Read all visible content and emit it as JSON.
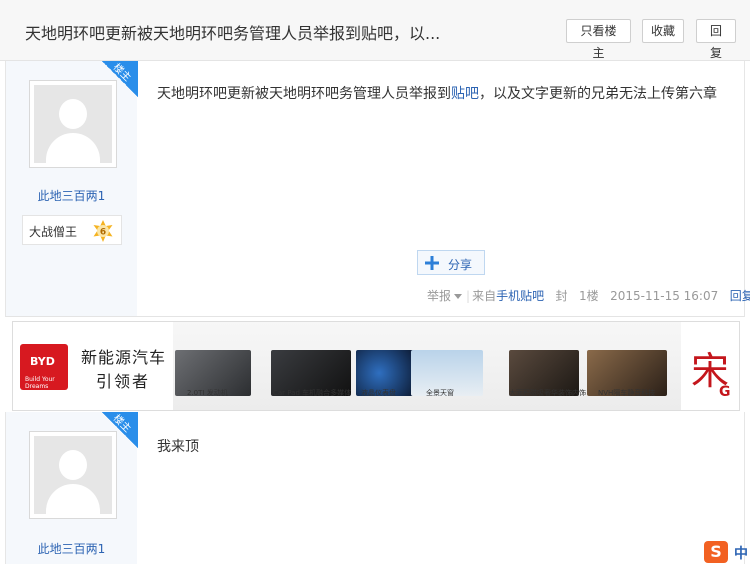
{
  "header": {
    "title": "天地明环吧更新被天地明环吧务管理人员举报到贴吧，以...",
    "buttons": {
      "only_op": "只看楼主",
      "favorite": "收藏",
      "reply": "回复"
    }
  },
  "posts": [
    {
      "corner_label": "楼主",
      "username": "此地三百两1",
      "badge": {
        "title": "大战僧王",
        "level": "6"
      },
      "content_prefix": "天地明环吧更新被天地明环吧务管理人员举报到",
      "content_link": "贴吧",
      "content_suffix": "，以及文字更新的兄弟无法上传第六章",
      "share_label": "分享",
      "meta": {
        "report": "举报",
        "from_prefix": "来自",
        "from_link": "手机贴吧",
        "icon_char": "封",
        "floor": "1楼",
        "time": "2015-11-15 16:07",
        "reply": "回复"
      }
    },
    {
      "corner_label": "楼主",
      "username": "此地三百两1",
      "content": "我来顶"
    }
  ],
  "ad": {
    "brand_logo": "BYD",
    "brand_sub": "Build Your Dreams",
    "slogan_line1": "新能源汽车",
    "slogan_line2": "引领者",
    "captions": [
      "2.0TI 发动机",
      "Car Pad 车机融合多媒体",
      "液晶仪表盘",
      "全景天窗",
      "大面积磁吸奢华装饰内饰",
      "NVH隔车静音科技"
    ],
    "right_logo": "宋",
    "right_logo_sub": "G",
    "colors": {
      "brand_red": "#d71920"
    }
  },
  "ime": {
    "logo": "S",
    "label": "中"
  },
  "colors": {
    "link_blue": "#2d64b3",
    "corner_blue": "#2a8eea",
    "sidebar_bg": "#f5f8fc"
  }
}
